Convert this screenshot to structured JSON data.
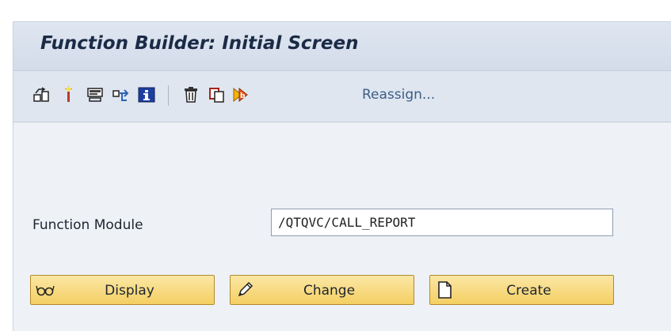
{
  "window": {
    "title": "Function Builder: Initial Screen"
  },
  "toolbar": {
    "icons": [
      "other-object-icon",
      "check-icon",
      "test-icon",
      "where-used-icon",
      "info-icon",
      "delete-icon",
      "copy-icon",
      "rename-icon"
    ],
    "reassign_label": "Reassign..."
  },
  "form": {
    "function_module_label": "Function Module",
    "function_module_value": "/QTQVC/CALL_REPORT"
  },
  "buttons": {
    "display_label": "Display",
    "change_label": "Change",
    "create_label": "Create"
  },
  "colors": {
    "title_bg": "#d3dcea",
    "toolbar_bg": "#dfe6f0",
    "content_bg": "#eef1f6",
    "button_bg": "#f4cf62",
    "link_text": "#3c5d86"
  }
}
